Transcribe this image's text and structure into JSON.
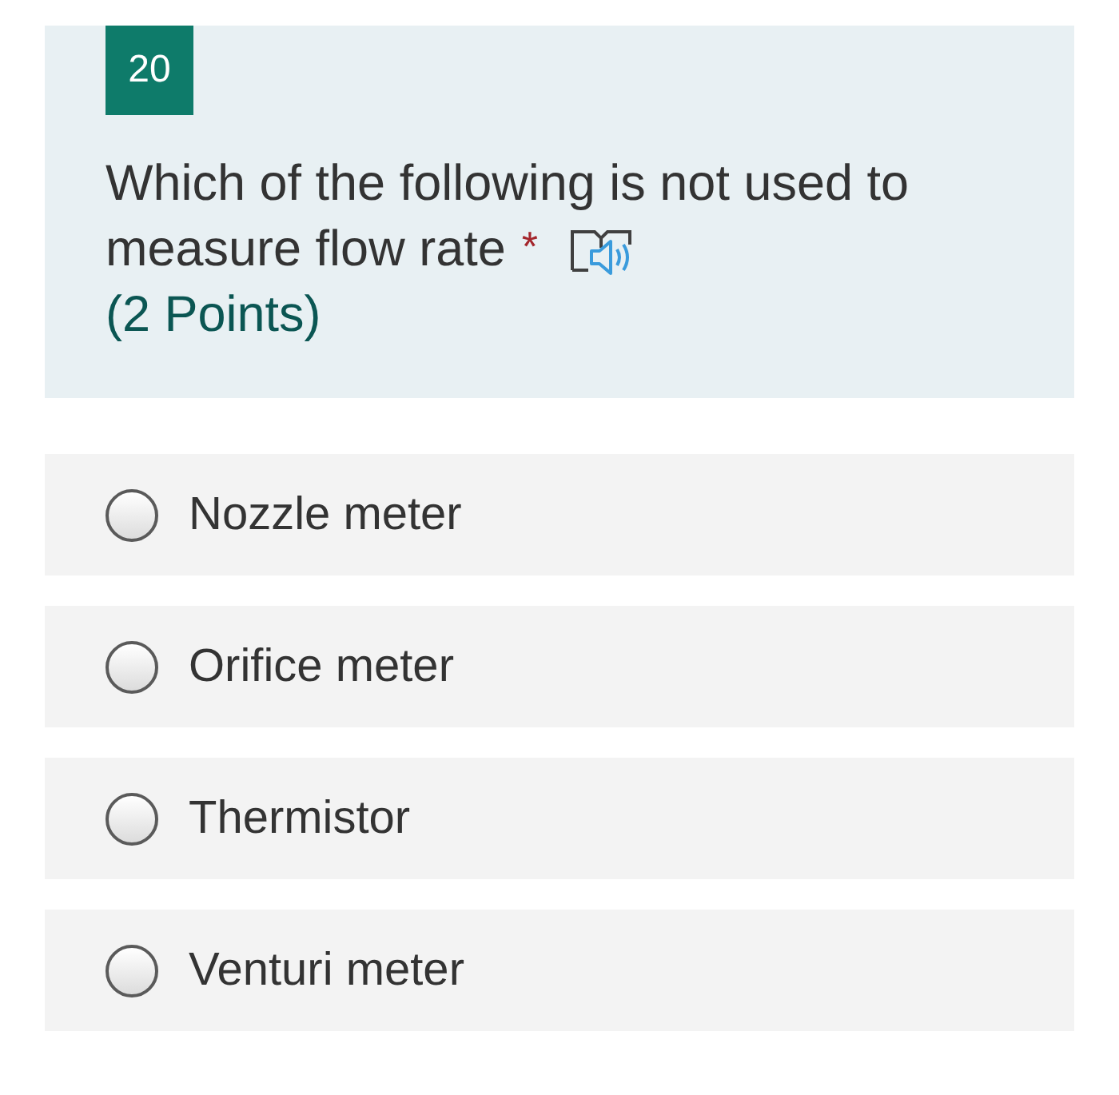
{
  "question": {
    "number": "20",
    "text_lines": [
      "Which of the following is not used to",
      "measure flow rate"
    ],
    "required_mark": "*",
    "points": "(2 Points)"
  },
  "options": [
    {
      "label": "Nozzle meter",
      "selected": false
    },
    {
      "label": "Orifice meter",
      "selected": false
    },
    {
      "label": "Thermistor",
      "selected": false
    },
    {
      "label": "Venturi meter",
      "selected": false
    }
  ]
}
